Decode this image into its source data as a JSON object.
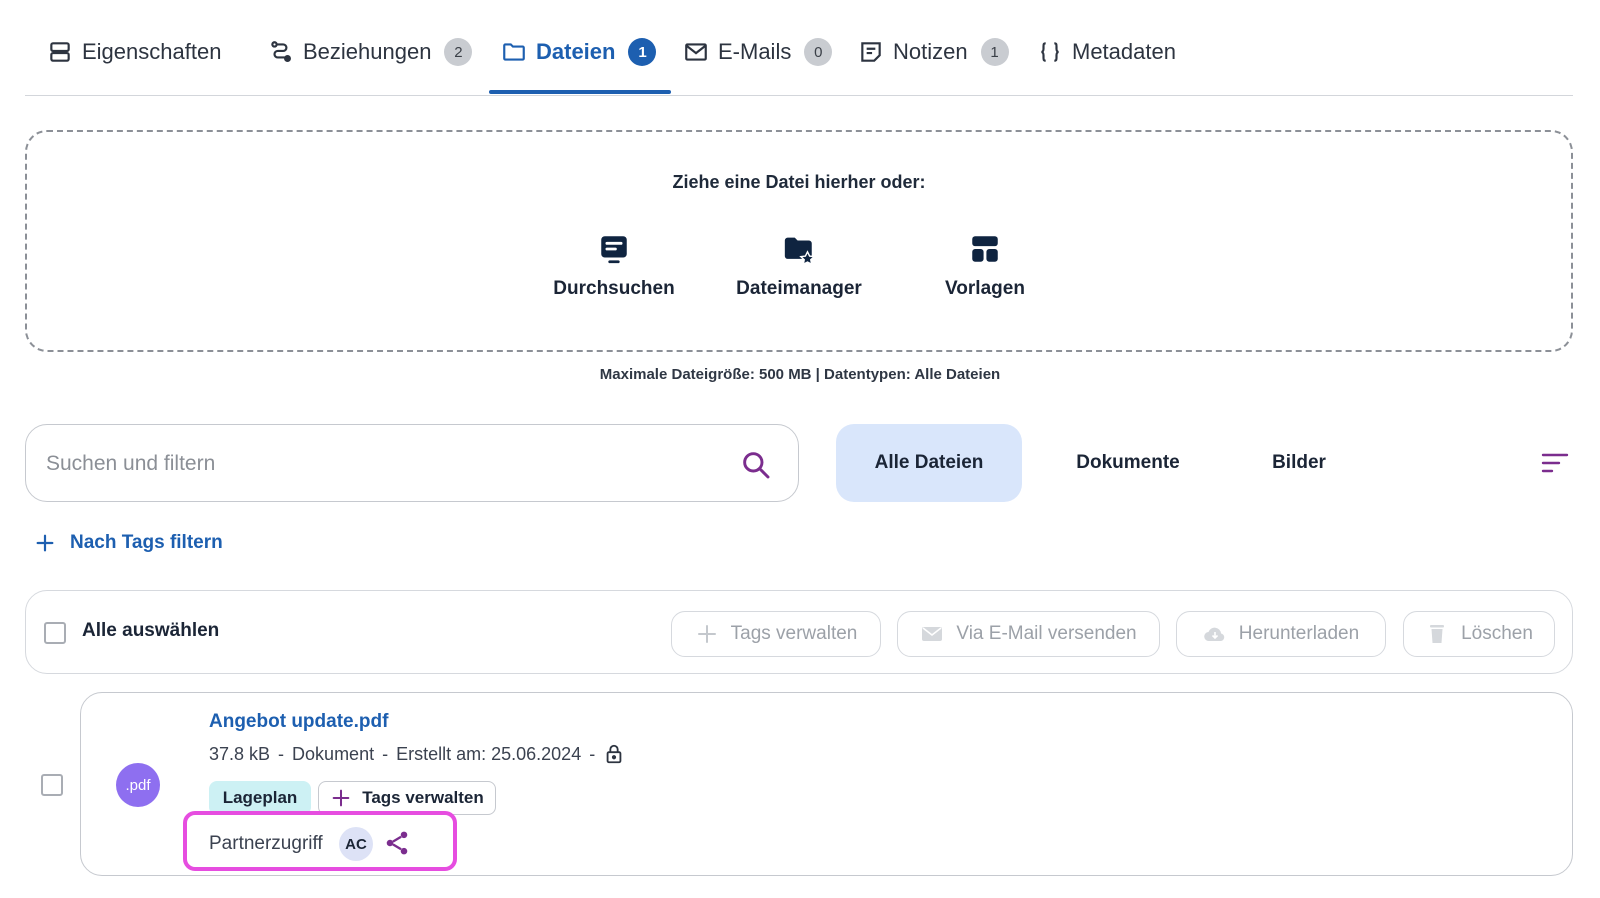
{
  "tabs": [
    {
      "label": "Eigenschaften",
      "icon": "properties-icon",
      "badge": ""
    },
    {
      "label": "Beziehungen",
      "icon": "relations-icon",
      "badge": "2"
    },
    {
      "label": "Dateien",
      "icon": "folder-icon",
      "badge": "1",
      "active": true
    },
    {
      "label": "E-Mails",
      "icon": "mail-icon",
      "badge": "0"
    },
    {
      "label": "Notizen",
      "icon": "notes-icon",
      "badge": "1"
    },
    {
      "label": "Metadaten",
      "icon": "braces-icon",
      "badge": ""
    }
  ],
  "dropzone": {
    "title": "Ziehe eine Datei hierher oder:",
    "actions": [
      {
        "label": "Durchsuchen",
        "icon": "browse-icon"
      },
      {
        "label": "Dateimanager",
        "icon": "file-manager-icon"
      },
      {
        "label": "Vorlagen",
        "icon": "templates-icon"
      }
    ],
    "hint": "Maximale Dateigröße: 500 MB  |  Datentypen: Alle Dateien"
  },
  "search": {
    "placeholder": "Suchen und filtern"
  },
  "filters": [
    {
      "label": "Alle Dateien",
      "active": true
    },
    {
      "label": "Dokumente",
      "active": false
    },
    {
      "label": "Bilder",
      "active": false
    }
  ],
  "tag_filter": {
    "label": "Nach Tags filtern"
  },
  "select_bar": {
    "select_all": "Alle auswählen",
    "actions": [
      "Tags verwalten",
      "Via E-Mail versenden",
      "Herunterladen",
      "Löschen"
    ]
  },
  "file": {
    "type_badge": ".pdf",
    "name": "Angebot update.pdf",
    "size": "37.8 kB",
    "kind": "Dokument",
    "created": "Erstellt am: 25.06.2024",
    "separator": "-",
    "tag": "Lageplan",
    "manage_tags": "Tags verwalten",
    "partner_label": "Partnerzugriff",
    "partner_avatar": "AC"
  },
  "colors": {
    "accent": "#1d5fb0",
    "filter_active_bg": "#d9e6fb",
    "pdf_badge": "#8e6ff0",
    "tag_bg": "#cdf1f4",
    "highlight": "#e64de0",
    "share": "#7b2d8e"
  }
}
